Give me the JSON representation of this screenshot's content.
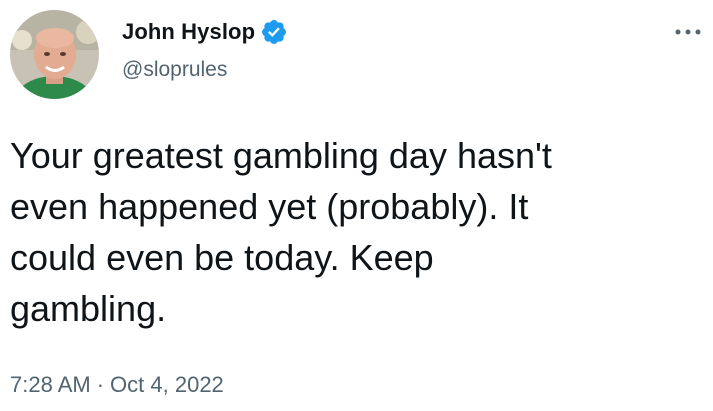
{
  "author": {
    "display_name": "John Hyslop",
    "handle": "@sloprules",
    "verified_icon": "verified-badge-icon",
    "verified_color": "#1d9bf0"
  },
  "menu": {
    "icon": "more-options-icon"
  },
  "tweet": {
    "text": "Your greatest gambling day hasn't\neven happened yet (probably). It\ncould even be today. Keep\ngambling.",
    "time": "7:28 AM",
    "separator": "·",
    "date": "Oct 4, 2022"
  },
  "colors": {
    "primary_text": "#0f1419",
    "secondary_text": "#536471",
    "background": "#ffffff"
  }
}
